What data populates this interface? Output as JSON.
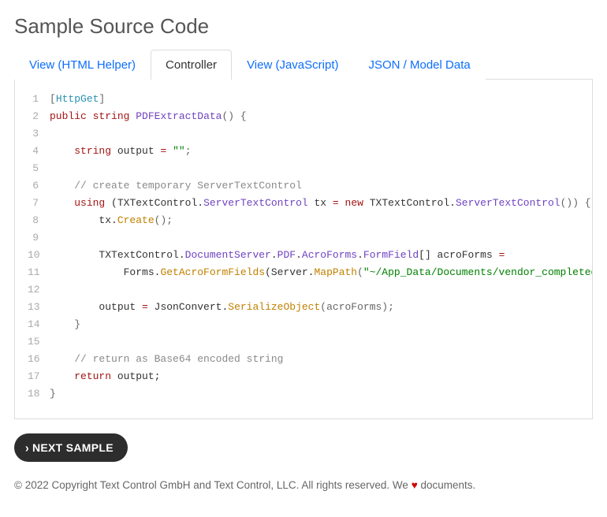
{
  "title": "Sample Source Code",
  "tabs": [
    {
      "label": "View (HTML Helper)",
      "active": false
    },
    {
      "label": "Controller",
      "active": true
    },
    {
      "label": "View (JavaScript)",
      "active": false
    },
    {
      "label": "JSON / Model Data",
      "active": false
    }
  ],
  "code": [
    {
      "n": "1",
      "tokens": [
        {
          "t": "[",
          "c": "punc"
        },
        {
          "t": "HttpGet",
          "c": "attr"
        },
        {
          "t": "]",
          "c": "punc"
        }
      ]
    },
    {
      "n": "2",
      "tokens": [
        {
          "t": "public",
          "c": "kw"
        },
        {
          "t": " ",
          "c": "id"
        },
        {
          "t": "string",
          "c": "kw"
        },
        {
          "t": " ",
          "c": "id"
        },
        {
          "t": "PDFExtractData",
          "c": "type"
        },
        {
          "t": "() {",
          "c": "punc"
        }
      ]
    },
    {
      "n": "3",
      "tokens": []
    },
    {
      "n": "4",
      "tokens": [
        {
          "t": "    ",
          "c": "id"
        },
        {
          "t": "string",
          "c": "kw"
        },
        {
          "t": " output ",
          "c": "id"
        },
        {
          "t": "=",
          "c": "op"
        },
        {
          "t": " ",
          "c": "id"
        },
        {
          "t": "\"\"",
          "c": "str"
        },
        {
          "t": ";",
          "c": "punc"
        }
      ]
    },
    {
      "n": "5",
      "tokens": []
    },
    {
      "n": "6",
      "tokens": [
        {
          "t": "    ",
          "c": "id"
        },
        {
          "t": "// create temporary ServerTextControl",
          "c": "cmt"
        }
      ]
    },
    {
      "n": "7",
      "tokens": [
        {
          "t": "    ",
          "c": "id"
        },
        {
          "t": "using",
          "c": "kw"
        },
        {
          "t": " (TXTextControl.",
          "c": "id"
        },
        {
          "t": "ServerTextControl",
          "c": "type"
        },
        {
          "t": " tx ",
          "c": "id"
        },
        {
          "t": "=",
          "c": "op"
        },
        {
          "t": " ",
          "c": "id"
        },
        {
          "t": "new",
          "c": "kw"
        },
        {
          "t": " TXTextControl.",
          "c": "id"
        },
        {
          "t": "ServerTextControl",
          "c": "type"
        },
        {
          "t": "()) {",
          "c": "punc"
        }
      ]
    },
    {
      "n": "8",
      "tokens": [
        {
          "t": "        tx.",
          "c": "id"
        },
        {
          "t": "Create",
          "c": "method"
        },
        {
          "t": "();",
          "c": "punc"
        }
      ]
    },
    {
      "n": "9",
      "tokens": []
    },
    {
      "n": "10",
      "tokens": [
        {
          "t": "        TXTextControl.",
          "c": "id"
        },
        {
          "t": "DocumentServer",
          "c": "type"
        },
        {
          "t": ".",
          "c": "id"
        },
        {
          "t": "PDF",
          "c": "type"
        },
        {
          "t": ".",
          "c": "id"
        },
        {
          "t": "AcroForms",
          "c": "type"
        },
        {
          "t": ".",
          "c": "id"
        },
        {
          "t": "FormField",
          "c": "type"
        },
        {
          "t": "[] acroForms ",
          "c": "id"
        },
        {
          "t": "=",
          "c": "op"
        }
      ]
    },
    {
      "n": "11",
      "tokens": [
        {
          "t": "            Forms.",
          "c": "id"
        },
        {
          "t": "GetAcroFormFields",
          "c": "method"
        },
        {
          "t": "(Server.",
          "c": "id"
        },
        {
          "t": "MapPath",
          "c": "method"
        },
        {
          "t": "(",
          "c": "punc"
        },
        {
          "t": "\"~/App_Data/Documents/vendor_completed.pdf\"",
          "c": "str"
        },
        {
          "t": "));",
          "c": "punc"
        }
      ]
    },
    {
      "n": "12",
      "tokens": []
    },
    {
      "n": "13",
      "tokens": [
        {
          "t": "        output ",
          "c": "id"
        },
        {
          "t": "=",
          "c": "op"
        },
        {
          "t": " JsonConvert.",
          "c": "id"
        },
        {
          "t": "SerializeObject",
          "c": "method"
        },
        {
          "t": "(acroForms);",
          "c": "punc"
        }
      ]
    },
    {
      "n": "14",
      "tokens": [
        {
          "t": "    }",
          "c": "punc"
        }
      ]
    },
    {
      "n": "15",
      "tokens": []
    },
    {
      "n": "16",
      "tokens": [
        {
          "t": "    ",
          "c": "id"
        },
        {
          "t": "// return as Base64 encoded string",
          "c": "cmt"
        }
      ]
    },
    {
      "n": "17",
      "tokens": [
        {
          "t": "    ",
          "c": "id"
        },
        {
          "t": "return",
          "c": "kw"
        },
        {
          "t": " output;",
          "c": "id"
        }
      ]
    },
    {
      "n": "18",
      "tokens": [
        {
          "t": "}",
          "c": "punc"
        }
      ]
    }
  ],
  "nextButton": {
    "chevron": "›",
    "label": "NEXT SAMPLE"
  },
  "footer": {
    "pre": "© 2022 Copyright Text Control GmbH and Text Control, LLC. All rights reserved. We ",
    "heart": "♥",
    "post": " documents."
  }
}
